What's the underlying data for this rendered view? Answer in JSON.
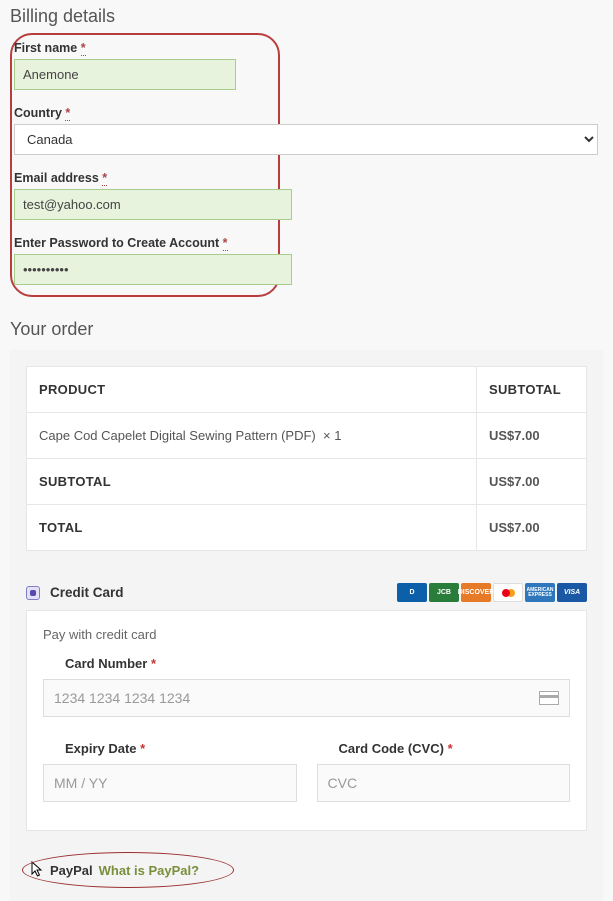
{
  "billing": {
    "heading": "Billing details",
    "first_name_label": "First name",
    "first_name_value": "Anemone",
    "country_label": "Country",
    "country_value": "Canada",
    "email_label": "Email address",
    "email_value": "test@yahoo.com",
    "password_label": "Enter Password to Create Account",
    "password_value": "••••••••••",
    "required_mark": "*"
  },
  "order": {
    "heading": "Your order",
    "col_product": "PRODUCT",
    "col_subtotal": "SUBTOTAL",
    "item_name": "Cape Cod Capelet Digital Sewing Pattern (PDF)",
    "item_qty": "× 1",
    "item_price": "US$7.00",
    "subtotal_label": "SUBTOTAL",
    "subtotal_value": "US$7.00",
    "total_label": "TOTAL",
    "total_value": "US$7.00"
  },
  "payment": {
    "cc_label": "Credit Card",
    "cc_desc": "Pay with credit card",
    "card_number_label": "Card Number",
    "card_number_placeholder": "1234 1234 1234 1234",
    "expiry_label": "Expiry Date",
    "expiry_placeholder": "MM / YY",
    "cvc_label": "Card Code (CVC)",
    "cvc_placeholder": "CVC",
    "req": "*",
    "paypal_label": "PayPal",
    "paypal_link": "What is PayPal?",
    "badges": {
      "diners": "D",
      "jcb": "JCB",
      "discover": "DISCOVER",
      "amex": "AMERICAN EXPRESS",
      "visa": "VISA"
    }
  }
}
